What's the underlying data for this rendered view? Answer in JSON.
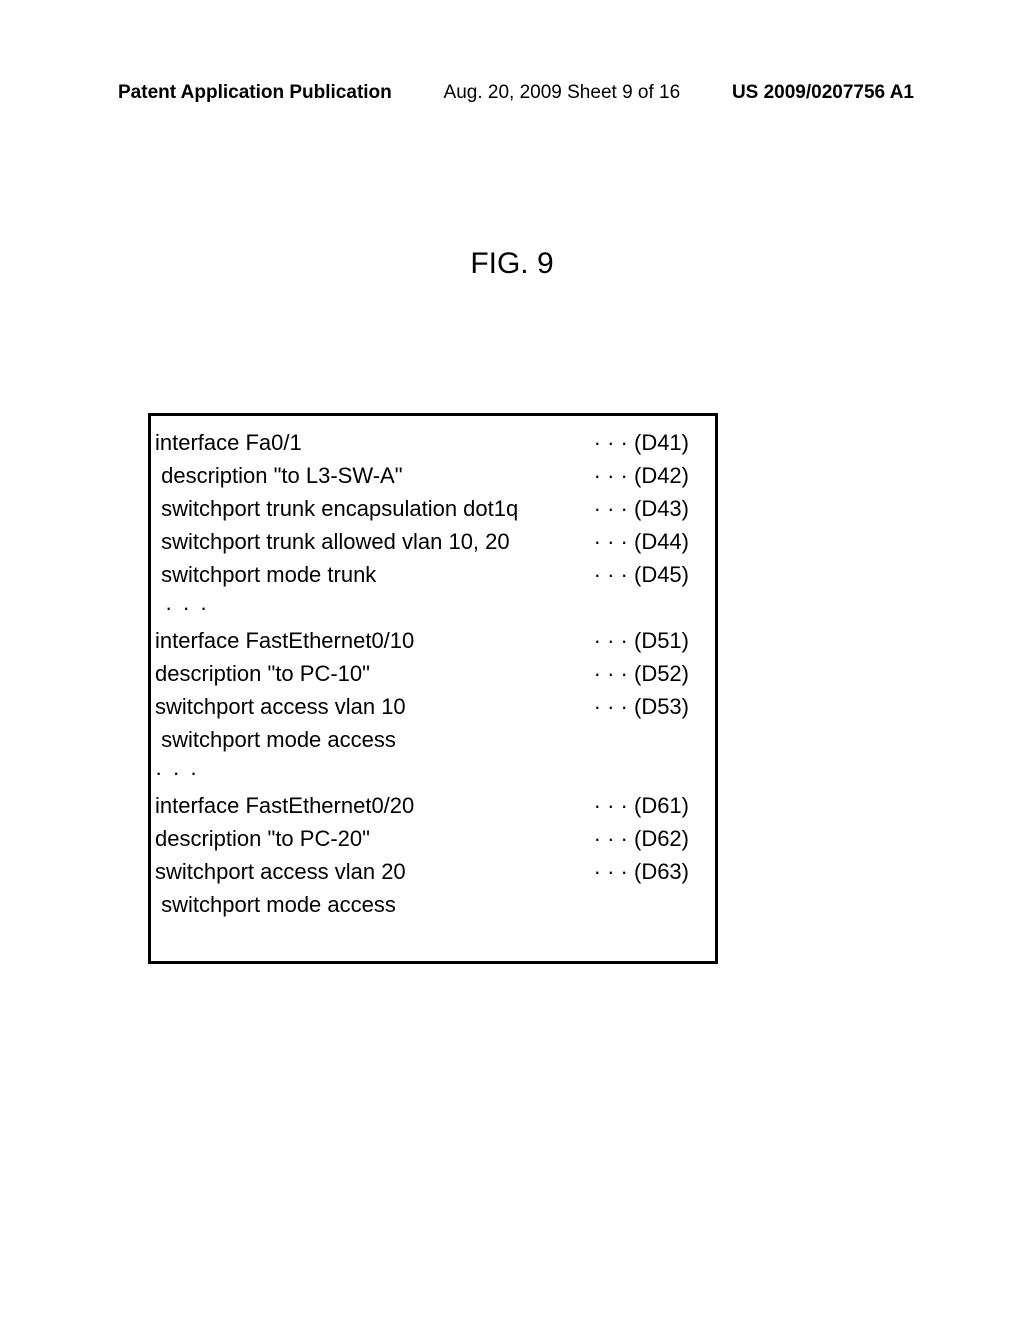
{
  "header": {
    "left": "Patent Application Publication",
    "mid": "Aug. 20, 2009  Sheet 9 of 16",
    "right": "US 2009/0207756 A1"
  },
  "fig_title": "FIG. 9",
  "block1": {
    "l1": {
      "txt": "interface Fa0/1",
      "ref": "· · · (D41)"
    },
    "l2": {
      "txt": " description \"to L3-SW-A\"",
      "ref": "· · · (D42)"
    },
    "l3": {
      "txt": " switchport trunk encapsulation dot1q",
      "ref": "· · · (D43)"
    },
    "l4": {
      "txt": " switchport trunk allowed vlan 10, 20",
      "ref": "· · · (D44)"
    },
    "l5": {
      "txt": " switchport mode trunk",
      "ref": "· · · (D45)"
    }
  },
  "ellipsis1": "· · ·",
  "block2": {
    "l1": {
      "txt": "interface FastEthernet0/10",
      "ref": "· · · (D51)"
    },
    "l2": {
      "txt": "description \"to PC-10\"",
      "ref": "· · · (D52)"
    },
    "l3": {
      "txt": "switchport access vlan 10",
      "ref": "· · · (D53)"
    },
    "l4": {
      "txt": " switchport mode access",
      "ref": ""
    }
  },
  "ellipsis2": "· · ·",
  "block3": {
    "l1": {
      "txt": "interface FastEthernet0/20",
      "ref": "· · · (D61)"
    },
    "l2": {
      "txt": "description \"to PC-20\"",
      "ref": "· · · (D62)"
    },
    "l3": {
      "txt": "switchport access vlan 20",
      "ref": "· · · (D63)"
    },
    "l4": {
      "txt": " switchport mode access",
      "ref": ""
    }
  }
}
